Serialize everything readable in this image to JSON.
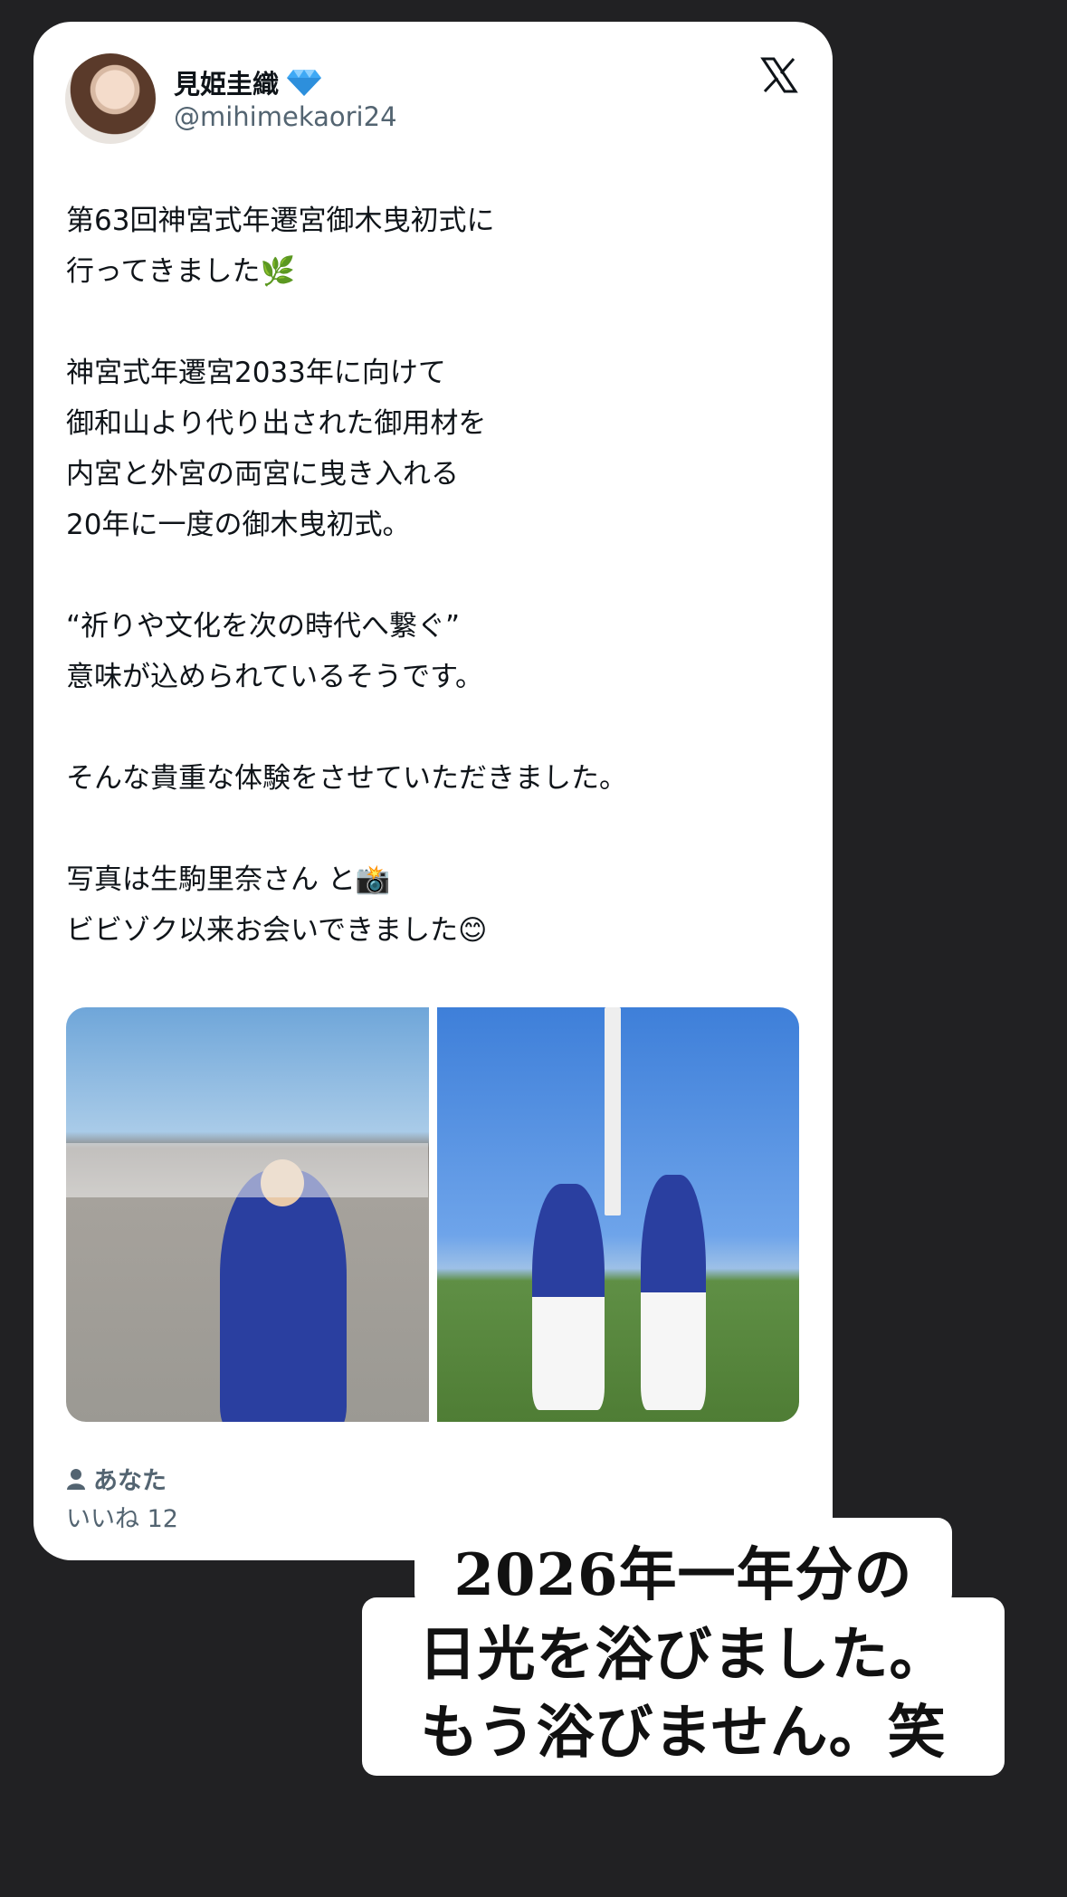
{
  "post": {
    "author_name": "見姫圭織",
    "verified_badge": "diamond-icon",
    "handle": "@mihimekaori24",
    "platform_logo": "x-logo-icon",
    "paragraphs": [
      "第63回神宮式年遷宮御木曳初式に\n行ってきました🌿",
      "神宮式年遷宮2033年に向けて\n御和山より代り出された御用材を\n内宮と外宮の両宮に曳き入れる\n20年に一度の御木曳初式。",
      "“祈りや文化を次の時代へ繋ぐ”\n意味が込められているそうです。",
      "そんな貴重な体験をさせていただきました。",
      "写真は生駒里奈さん と📸\nビビゾク以来お会いできました😊"
    ],
    "liked_by_label": "あなた",
    "likes_label": "いいね 12"
  },
  "caption": {
    "line1": "2026年一年分の",
    "line2": "日光を浴びました。",
    "line3": "もう浴びません。笑"
  },
  "colors": {
    "background": "#212123",
    "card": "#ffffff",
    "text": "#0f1419",
    "muted": "#536471",
    "badge": "#3fa9f5"
  }
}
